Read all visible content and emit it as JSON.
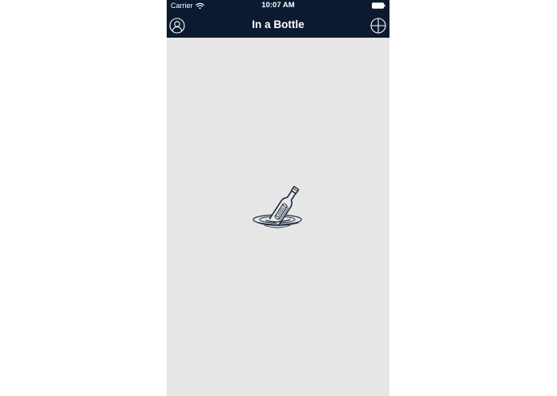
{
  "status_bar": {
    "carrier": "Carrier",
    "time": "10:07 AM",
    "wifi_icon": "wifi-icon",
    "battery_icon": "battery-icon"
  },
  "nav_bar": {
    "title": "In a Bottle",
    "left_icon": "profile-icon",
    "right_icon": "add-icon",
    "background": "#0b1a30"
  },
  "content": {
    "background": "#e6e6e6",
    "illustration_icon": "message-in-bottle-icon"
  }
}
